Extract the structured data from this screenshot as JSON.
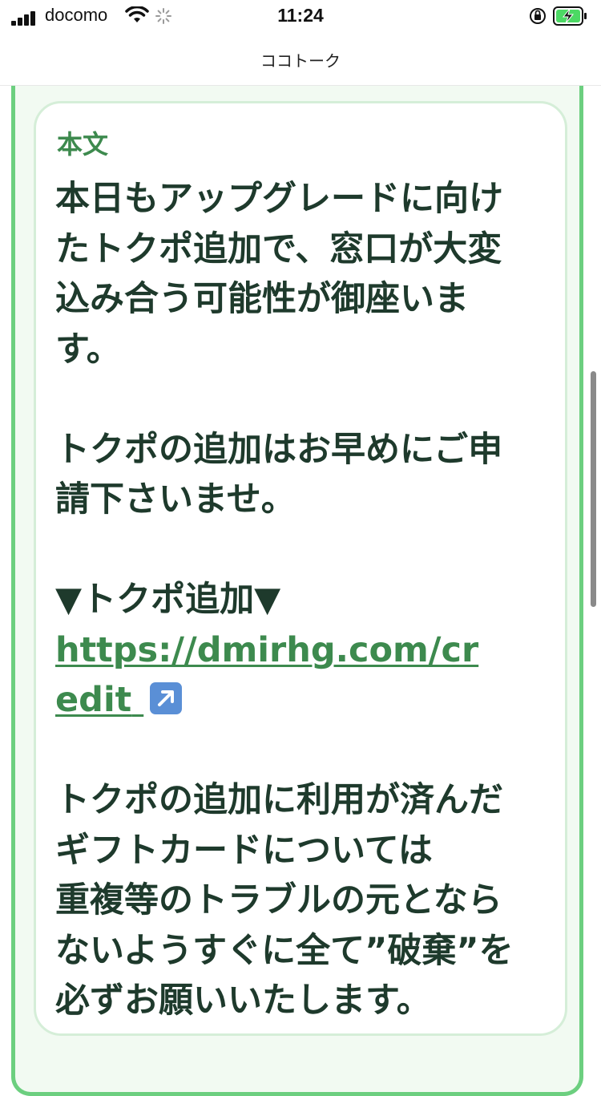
{
  "status_bar": {
    "carrier": "docomo",
    "time": "11:24",
    "icons": [
      "signal-icon",
      "wifi-icon",
      "loading-spinner-icon",
      "orientation-lock-icon",
      "battery-charging-icon"
    ],
    "battery_color": "#4cd964"
  },
  "nav": {
    "title": "ココトーク"
  },
  "card": {
    "label": "本文",
    "paragraph1": [
      "本日もアップグレードに向け",
      "たトクポ追加で、窓口が大変",
      "込み合う可能性が御座いま",
      "す。"
    ],
    "paragraph2": [
      "トクポの追加はお早めにご申",
      "請下さいませ。"
    ],
    "link_header": "▼トクポ追加▼",
    "link_lines": [
      "https://dmirhg.com/cr",
      "edit"
    ],
    "link_icon": "up-right-arrow-icon",
    "paragraph3": [
      "トクポの追加に利用が済んだ",
      "ギフトカードについては",
      "重複等のトラブルの元となら",
      "ないようすぐに全て”破棄”を",
      "必ずお願いいたします。"
    ]
  },
  "colors": {
    "accent_green": "#6ccf7f",
    "label_green": "#3d8a4e",
    "text_dark_green": "#1e3a2c"
  }
}
